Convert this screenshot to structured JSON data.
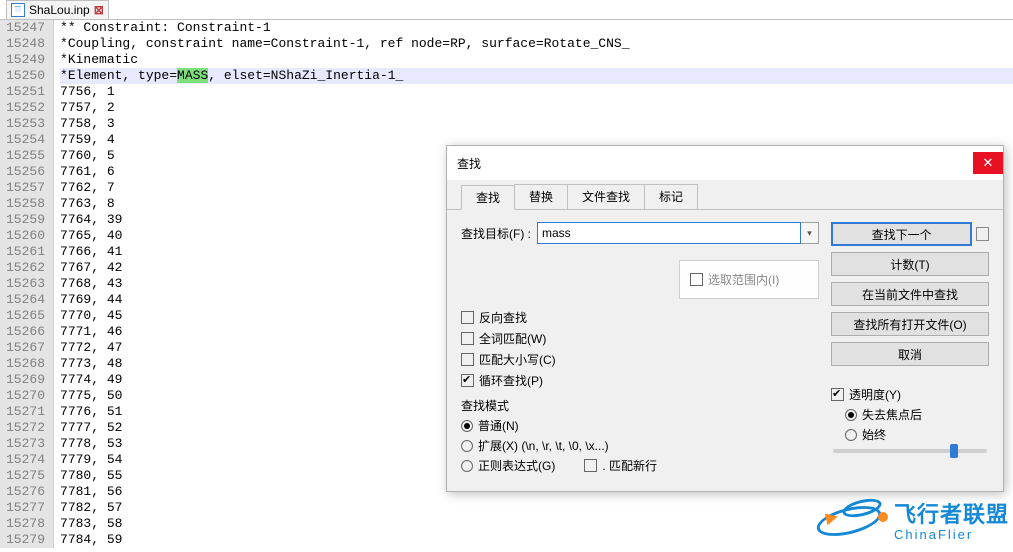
{
  "tab": {
    "filename": "ShaLou.inp"
  },
  "editor": {
    "highlight": "MASS",
    "lines": [
      {
        "n": 15247,
        "t": "** Constraint: Constraint-1"
      },
      {
        "n": 15248,
        "t": "*Coupling, constraint name=Constraint-1, ref node=RP, surface=Rotate_CNS_"
      },
      {
        "n": 15249,
        "t": "*Kinematic"
      },
      {
        "n": 15250,
        "pre": "*Element, type=",
        "hl": "MASS",
        "post": ", elset=NShaZi_Inertia-1_",
        "current": true
      },
      {
        "n": 15251,
        "t": "7756, 1"
      },
      {
        "n": 15252,
        "t": "7757, 2"
      },
      {
        "n": 15253,
        "t": "7758, 3"
      },
      {
        "n": 15254,
        "t": "7759, 4"
      },
      {
        "n": 15255,
        "t": "7760, 5"
      },
      {
        "n": 15256,
        "t": "7761, 6"
      },
      {
        "n": 15257,
        "t": "7762, 7"
      },
      {
        "n": 15258,
        "t": "7763, 8"
      },
      {
        "n": 15259,
        "t": "7764, 39"
      },
      {
        "n": 15260,
        "t": "7765, 40"
      },
      {
        "n": 15261,
        "t": "7766, 41"
      },
      {
        "n": 15262,
        "t": "7767, 42"
      },
      {
        "n": 15263,
        "t": "7768, 43"
      },
      {
        "n": 15264,
        "t": "7769, 44"
      },
      {
        "n": 15265,
        "t": "7770, 45"
      },
      {
        "n": 15266,
        "t": "7771, 46"
      },
      {
        "n": 15267,
        "t": "7772, 47"
      },
      {
        "n": 15268,
        "t": "7773, 48"
      },
      {
        "n": 15269,
        "t": "7774, 49"
      },
      {
        "n": 15270,
        "t": "7775, 50"
      },
      {
        "n": 15271,
        "t": "7776, 51"
      },
      {
        "n": 15272,
        "t": "7777, 52"
      },
      {
        "n": 15273,
        "t": "7778, 53"
      },
      {
        "n": 15274,
        "t": "7779, 54"
      },
      {
        "n": 15275,
        "t": "7780, 55"
      },
      {
        "n": 15276,
        "t": "7781, 56"
      },
      {
        "n": 15277,
        "t": "7782, 57"
      },
      {
        "n": 15278,
        "t": "7783, 58"
      },
      {
        "n": 15279,
        "t": "7784, 59"
      }
    ]
  },
  "dialog": {
    "title": "查找",
    "tabs": {
      "find": "查找",
      "replace": "替换",
      "findfiles": "文件查找",
      "mark": "标记"
    },
    "target_label": "查找目标(F) :",
    "target_value": "mass",
    "buttons": {
      "find_next": "查找下一个",
      "count": "计数(T)",
      "find_in_current": "在当前文件中查找",
      "find_in_all_open": "查找所有打开文件(O)",
      "cancel": "取消"
    },
    "inselection": "选取范围内(I)",
    "options": {
      "backward": "反向查找",
      "whole_word": "全词匹配(W)",
      "match_case": "匹配大小写(C)",
      "wrap": "循环查找(P)"
    },
    "mode": {
      "label": "查找模式",
      "normal": "普通(N)",
      "extended": "扩展(X) (\\n, \\r, \\t, \\0, \\x...)",
      "regex": "正则表达式(G)",
      "match_newline": ". 匹配新行"
    },
    "transparency": {
      "label": "透明度(Y)",
      "on_lose_focus": "失去焦点后",
      "always": "始终"
    }
  },
  "watermark": {
    "cn": "飞行者联盟",
    "en": "ChinaFlier"
  }
}
